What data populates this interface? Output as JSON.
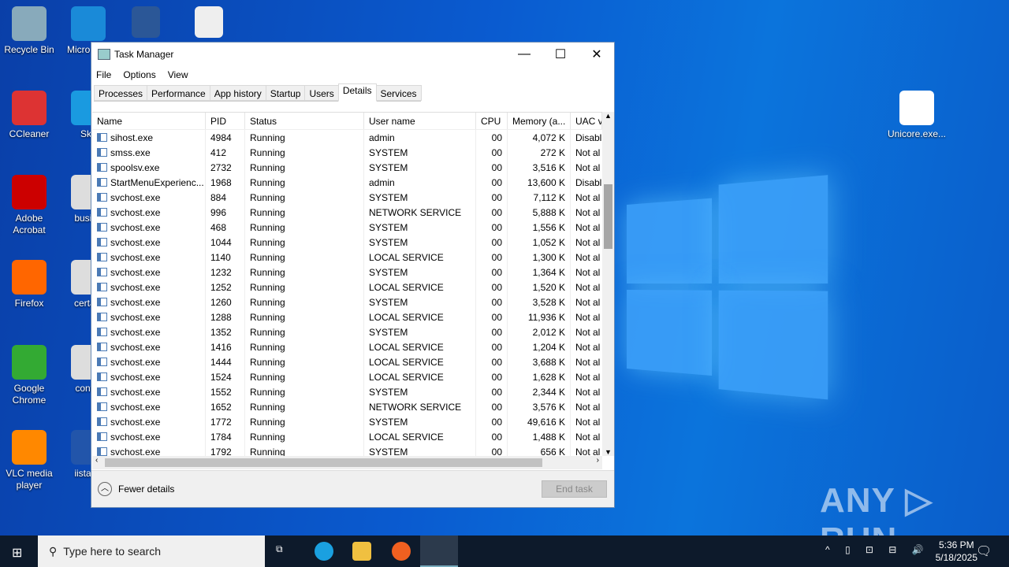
{
  "desktop": {
    "icons": [
      "Recycle Bin",
      "Micro Edg",
      "CCleaner",
      "Sky",
      "Adobe Acrobat",
      "busine",
      "Firefox",
      "certain",
      "Google Chrome",
      "contro",
      "VLC media player",
      "iistartu",
      "Unicore.exe..."
    ]
  },
  "window": {
    "title": "Task Manager",
    "menu": [
      "File",
      "Options",
      "View"
    ],
    "tabs": [
      "Processes",
      "Performance",
      "App history",
      "Startup",
      "Users",
      "Details",
      "Services"
    ],
    "active_tab": "Details",
    "columns": [
      "Name",
      "PID",
      "Status",
      "User name",
      "CPU",
      "Memory (a...",
      "UAC v"
    ],
    "rows": [
      [
        "sihost.exe",
        "4984",
        "Running",
        "admin",
        "00",
        "4,072 K",
        "Disabl"
      ],
      [
        "smss.exe",
        "412",
        "Running",
        "SYSTEM",
        "00",
        "272 K",
        "Not al"
      ],
      [
        "spoolsv.exe",
        "2732",
        "Running",
        "SYSTEM",
        "00",
        "3,516 K",
        "Not al"
      ],
      [
        "StartMenuExperienc...",
        "1968",
        "Running",
        "admin",
        "00",
        "13,600 K",
        "Disabl"
      ],
      [
        "svchost.exe",
        "884",
        "Running",
        "SYSTEM",
        "00",
        "7,112 K",
        "Not al"
      ],
      [
        "svchost.exe",
        "996",
        "Running",
        "NETWORK SERVICE",
        "00",
        "5,888 K",
        "Not al"
      ],
      [
        "svchost.exe",
        "468",
        "Running",
        "SYSTEM",
        "00",
        "1,556 K",
        "Not al"
      ],
      [
        "svchost.exe",
        "1044",
        "Running",
        "SYSTEM",
        "00",
        "1,052 K",
        "Not al"
      ],
      [
        "svchost.exe",
        "1140",
        "Running",
        "LOCAL SERVICE",
        "00",
        "1,300 K",
        "Not al"
      ],
      [
        "svchost.exe",
        "1232",
        "Running",
        "SYSTEM",
        "00",
        "1,364 K",
        "Not al"
      ],
      [
        "svchost.exe",
        "1252",
        "Running",
        "LOCAL SERVICE",
        "00",
        "1,520 K",
        "Not al"
      ],
      [
        "svchost.exe",
        "1260",
        "Running",
        "SYSTEM",
        "00",
        "3,528 K",
        "Not al"
      ],
      [
        "svchost.exe",
        "1288",
        "Running",
        "LOCAL SERVICE",
        "00",
        "11,936 K",
        "Not al"
      ],
      [
        "svchost.exe",
        "1352",
        "Running",
        "SYSTEM",
        "00",
        "2,012 K",
        "Not al"
      ],
      [
        "svchost.exe",
        "1416",
        "Running",
        "LOCAL SERVICE",
        "00",
        "1,204 K",
        "Not al"
      ],
      [
        "svchost.exe",
        "1444",
        "Running",
        "LOCAL SERVICE",
        "00",
        "3,688 K",
        "Not al"
      ],
      [
        "svchost.exe",
        "1524",
        "Running",
        "LOCAL SERVICE",
        "00",
        "1,628 K",
        "Not al"
      ],
      [
        "svchost.exe",
        "1552",
        "Running",
        "SYSTEM",
        "00",
        "2,344 K",
        "Not al"
      ],
      [
        "svchost.exe",
        "1652",
        "Running",
        "NETWORK SERVICE",
        "00",
        "3,576 K",
        "Not al"
      ],
      [
        "svchost.exe",
        "1772",
        "Running",
        "SYSTEM",
        "00",
        "49,616 K",
        "Not al"
      ],
      [
        "svchost.exe",
        "1784",
        "Running",
        "LOCAL SERVICE",
        "00",
        "1,488 K",
        "Not al"
      ],
      [
        "svchost.exe",
        "1792",
        "Running",
        "SYSTEM",
        "00",
        "656 K",
        "Not al"
      ]
    ],
    "fewer_details": "Fewer details",
    "end_task": "End task"
  },
  "taskbar": {
    "search_placeholder": "Type here to search",
    "time": "5:36 PM",
    "date": "5/18/2025"
  },
  "watermark": "ANY ▷ RUN"
}
